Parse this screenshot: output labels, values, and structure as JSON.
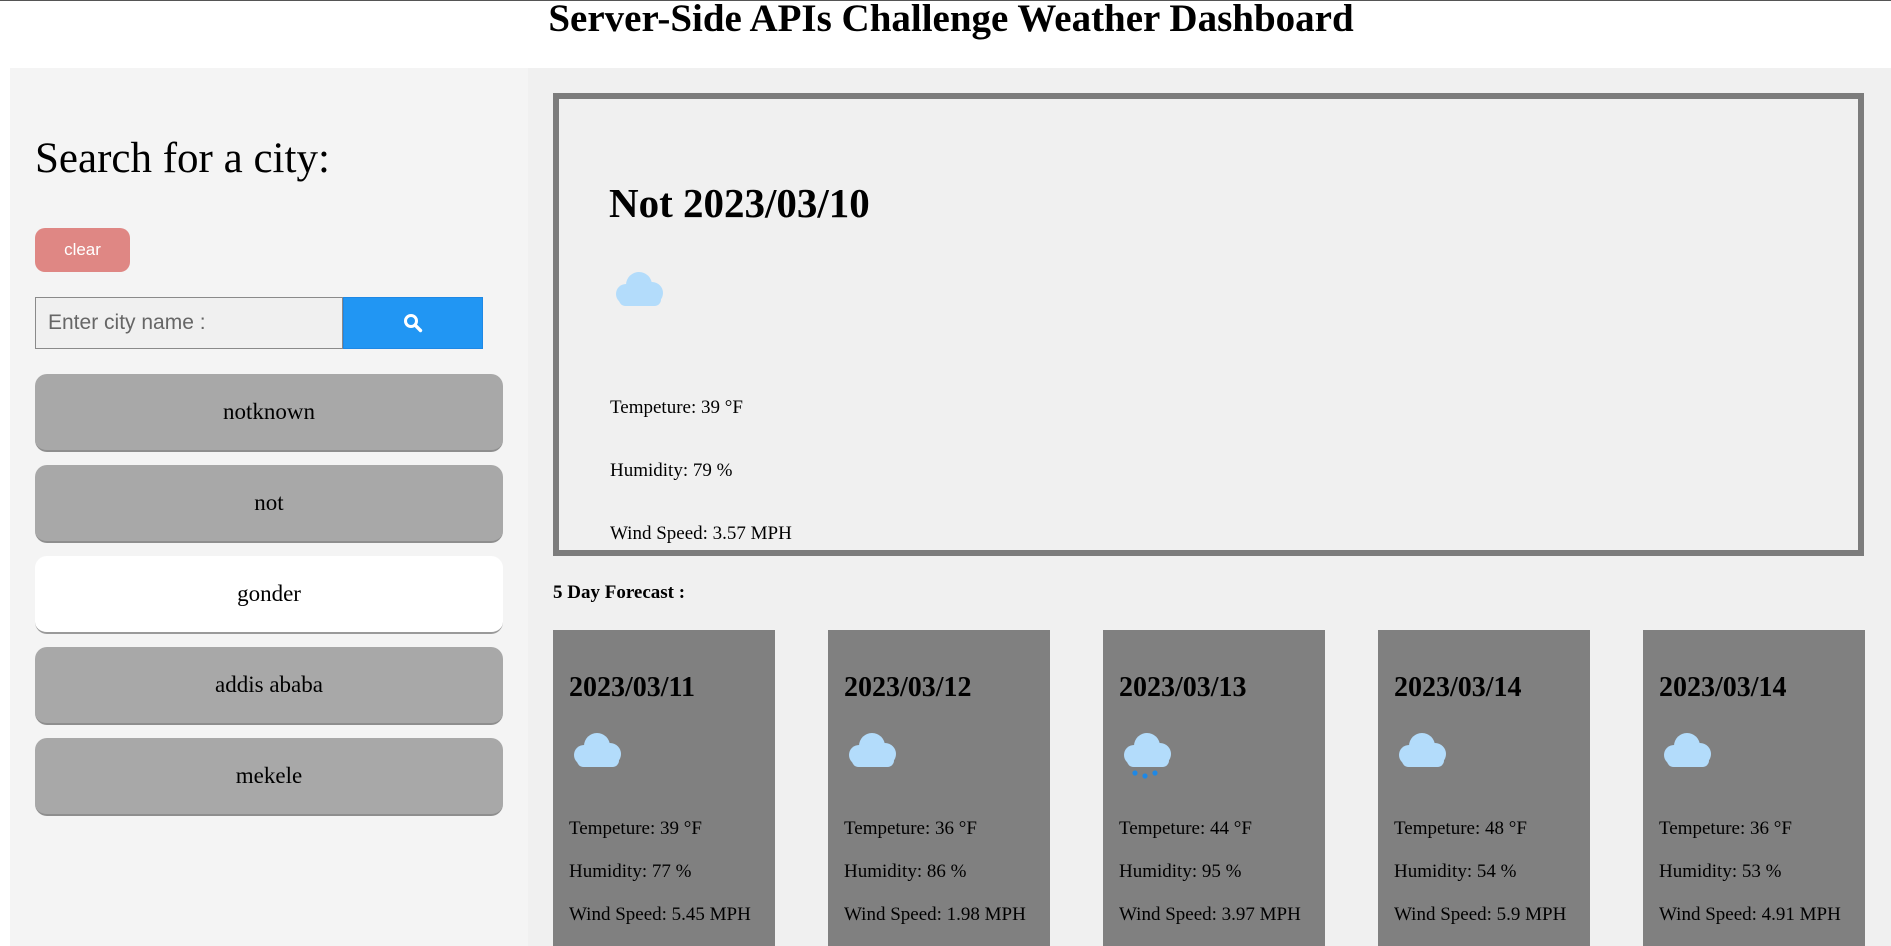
{
  "app_title": "Server-Side APIs Challenge Weather Dashboard",
  "sidebar": {
    "heading": "Search for a city:",
    "clear_label": "clear",
    "input_placeholder": "Enter city name :",
    "search_icon": "search-icon",
    "history": [
      {
        "label": "notknown",
        "active": false
      },
      {
        "label": "not",
        "active": false
      },
      {
        "label": "gonder",
        "active": true
      },
      {
        "label": "addis ababa",
        "active": false
      },
      {
        "label": "mekele",
        "active": false
      }
    ]
  },
  "current": {
    "title": "Not 2023/03/10",
    "icon": "cloud-icon",
    "temperature": "Tempeture: 39 °F",
    "humidity": "Humidity: 79 %",
    "wind": "Wind Speed: 3.57 MPH"
  },
  "forecast": {
    "heading": "5 Day Forecast :",
    "days": [
      {
        "date": "2023/03/11",
        "icon": "cloud-icon",
        "temperature": "Tempeture: 39 °F",
        "humidity": "Humidity: 77 %",
        "wind": "Wind Speed: 5.45 MPH"
      },
      {
        "date": "2023/03/12",
        "icon": "cloud-icon",
        "temperature": "Tempeture: 36 °F",
        "humidity": "Humidity: 86 %",
        "wind": "Wind Speed: 1.98 MPH"
      },
      {
        "date": "2023/03/13",
        "icon": "rain-cloud-icon",
        "temperature": "Tempeture: 44 °F",
        "humidity": "Humidity: 95 %",
        "wind": "Wind Speed: 3.97 MPH"
      },
      {
        "date": "2023/03/14",
        "icon": "cloud-icon",
        "temperature": "Tempeture: 48 °F",
        "humidity": "Humidity: 54 %",
        "wind": "Wind Speed: 5.9 MPH"
      },
      {
        "date": "2023/03/14",
        "icon": "cloud-icon",
        "temperature": "Tempeture: 36 °F",
        "humidity": "Humidity: 53 %",
        "wind": "Wind Speed: 4.91 MPH"
      }
    ]
  },
  "colors": {
    "clear_button": "#df8784",
    "search_button": "#2196f3",
    "history_item": "#a8a8a8",
    "forecast_card": "#808080",
    "cloud": "#b3dcfb",
    "rain": "#1e88e5"
  }
}
